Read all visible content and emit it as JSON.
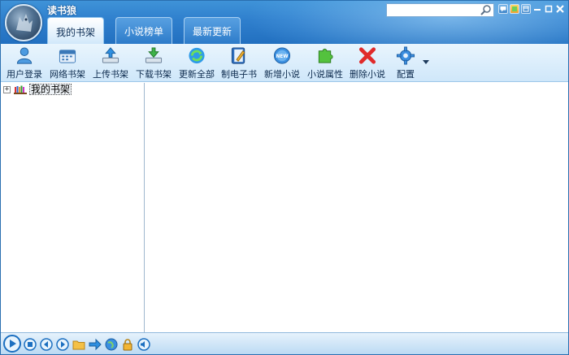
{
  "app": {
    "title": "读书狼"
  },
  "tabs": [
    {
      "label": "我的书架",
      "active": true
    },
    {
      "label": "小说榜单",
      "active": false
    },
    {
      "label": "最新更新",
      "active": false
    }
  ],
  "search": {
    "value": "",
    "placeholder": ""
  },
  "toolbar": {
    "items": [
      {
        "label": "用户登录",
        "icon": "user-icon"
      },
      {
        "label": "网络书架",
        "icon": "calendar-icon"
      },
      {
        "label": "上传书架",
        "icon": "upload-icon"
      },
      {
        "label": "下载书架",
        "icon": "download-icon"
      },
      {
        "label": "更新全部",
        "icon": "refresh-icon"
      },
      {
        "label": "制电子书",
        "icon": "ebook-icon"
      },
      {
        "label": "新增小说",
        "icon": "new-icon"
      },
      {
        "label": "小说属性",
        "icon": "puzzle-icon"
      },
      {
        "label": "删除小说",
        "icon": "delete-icon"
      },
      {
        "label": "配置",
        "icon": "gear-icon"
      }
    ]
  },
  "tree": {
    "root_label": "我的书架",
    "expander": "+"
  },
  "colors": {
    "header": "#2f7fcd",
    "toolbar": "#d8ecfb",
    "accent": "#1a6fc0"
  }
}
